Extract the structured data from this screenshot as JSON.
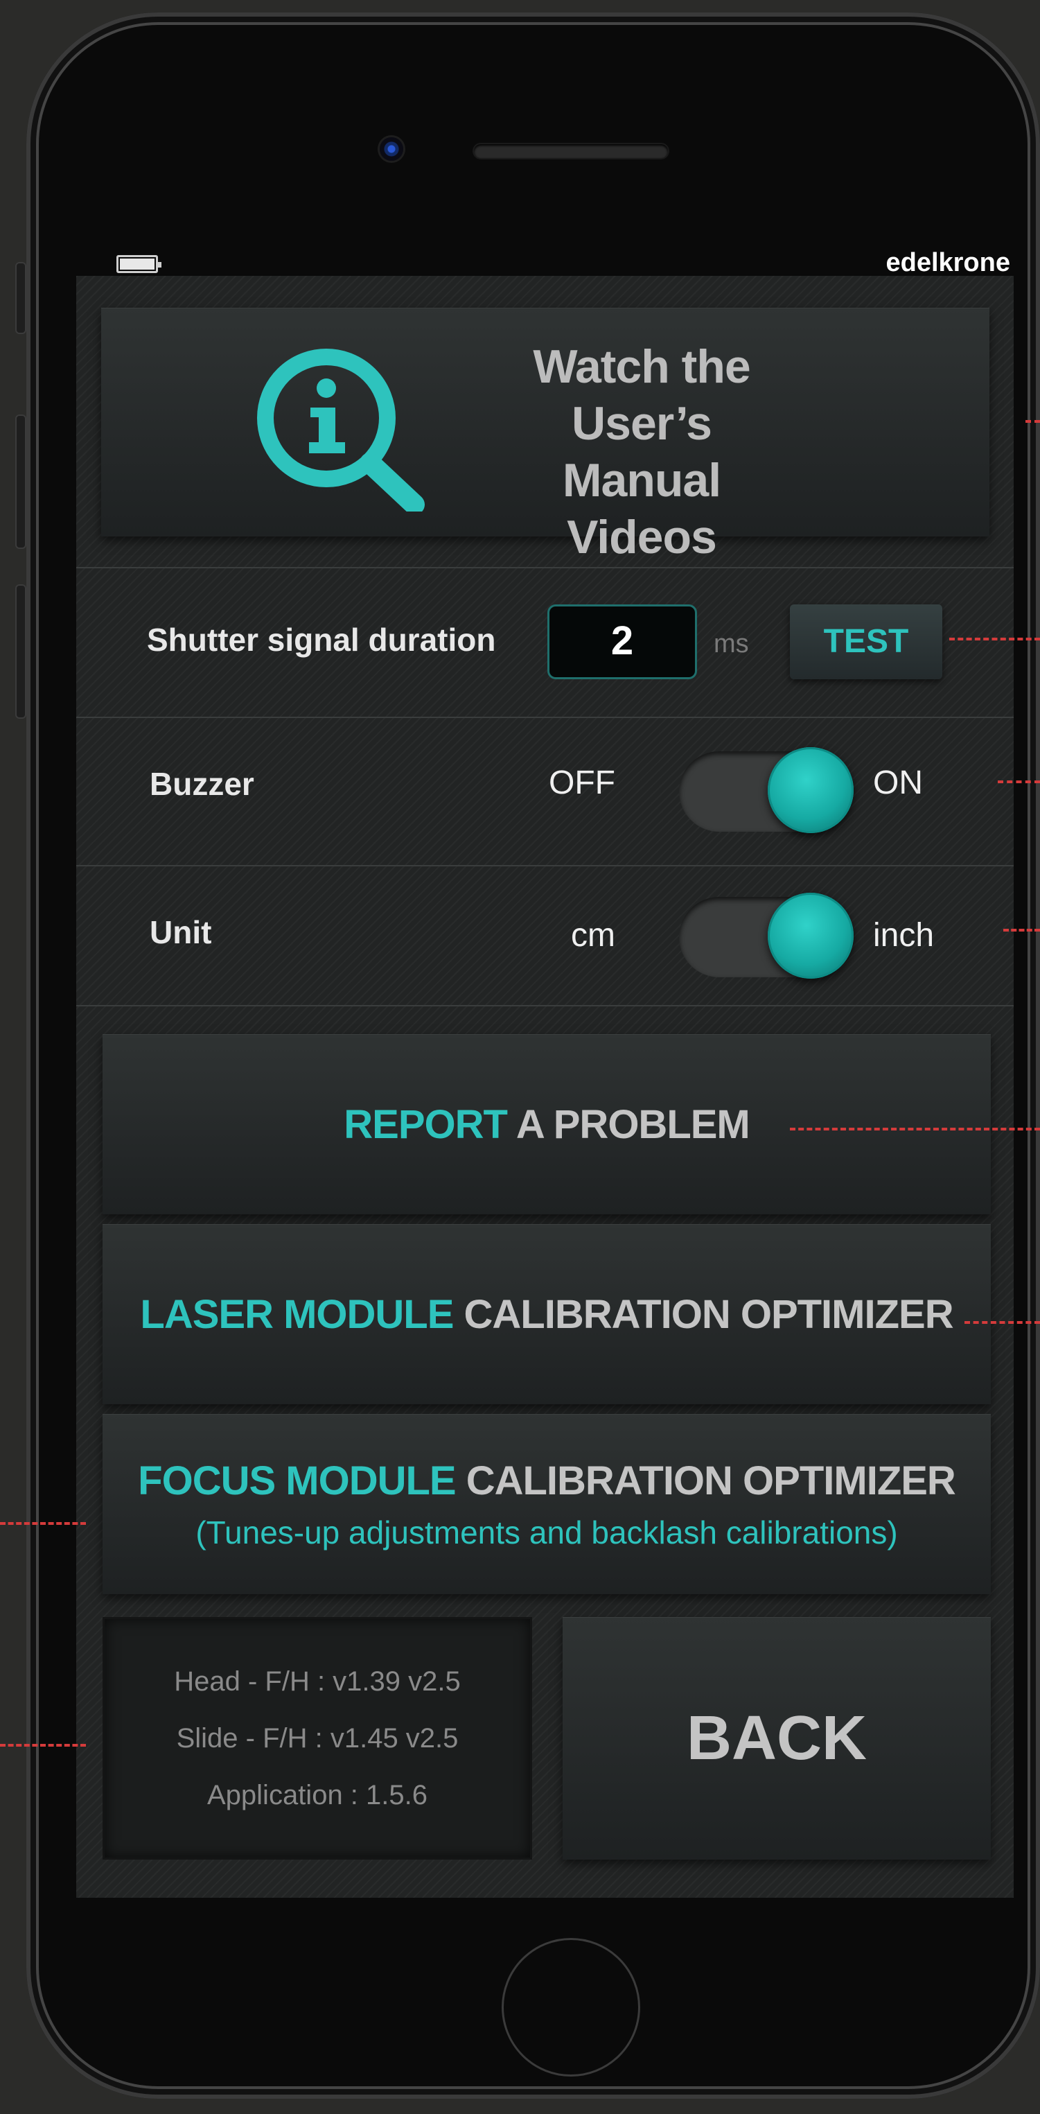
{
  "status_bar": {
    "brand": "edelkrone"
  },
  "manual": {
    "line1": "Watch the",
    "line2": "User’s Manual",
    "line3": "Videos"
  },
  "shutter": {
    "label": "Shutter signal duration",
    "value": "2",
    "unit": "ms",
    "test_label": "TEST"
  },
  "buzzer": {
    "label": "Buzzer",
    "off_label": "OFF",
    "on_label": "ON",
    "state": "on"
  },
  "unit": {
    "label": "Unit",
    "off_label": "cm",
    "on_label": "inch",
    "state": "inch"
  },
  "report": {
    "accent": "REPORT",
    "rest": " A PROBLEM"
  },
  "laser": {
    "accent": "LASER MODULE",
    "rest": " CALIBRATION OPTIMIZER"
  },
  "focus": {
    "accent": "FOCUS MODULE",
    "rest": " CALIBRATION OPTIMIZER",
    "subtitle": "(Tunes-up adjustments and backlash calibrations)"
  },
  "versions": {
    "head": "Head - F/H : v1.39 v2.5",
    "slide": "Slide - F/H : v1.45 v2.5",
    "application": "Application : 1.5.6"
  },
  "back": {
    "label": "BACK"
  },
  "colors": {
    "accent": "#2ec3bd",
    "annotation_line": "#d43b3b",
    "background": "#222424"
  },
  "icons": {
    "manual": "info-magnifier-icon"
  }
}
